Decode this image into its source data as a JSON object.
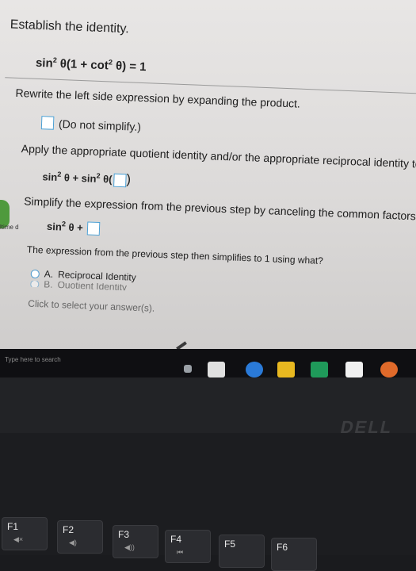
{
  "problem": {
    "title": "Establish the identity.",
    "identity": {
      "a": "sin",
      "sup1": "2",
      "b": "θ(1 + cot",
      "sup2": "2",
      "c": "θ) = 1"
    }
  },
  "steps": [
    {
      "text": "Rewrite the left side expression by expanding the product."
    },
    {
      "note": "(Do not simplify.)"
    },
    {
      "text": "Apply the appropriate quotient identity and/or the appropriate reciprocal identity to"
    },
    {
      "eq": {
        "a": "sin",
        "sup1": "2",
        "b": "θ + sin",
        "sup2": "2",
        "c": "θ("
      }
    },
    {
      "text": "Simplify the expression from the previous step by canceling the common factors."
    },
    {
      "eq": {
        "a": "sin",
        "sup1": "2",
        "b": "θ +"
      }
    },
    {
      "text": "The expression from the previous step then simplifies to 1 using what?"
    }
  ],
  "choices": [
    {
      "label": "A.",
      "text": "Reciprocal Identity"
    },
    {
      "label": "B.",
      "text": "Quotient Identity"
    }
  ],
  "hint": "Click to select your answer(s).",
  "sidebar": {
    "time": "ltime d"
  },
  "taskbar": {
    "search_placeholder": "Type here to search"
  },
  "laptop": {
    "brand": "DELL"
  },
  "keys": [
    {
      "label": "F1",
      "sub": "◀×"
    },
    {
      "label": "F2",
      "sub": "◀)"
    },
    {
      "label": "F3",
      "sub": "◀))"
    },
    {
      "label": "F4",
      "sub": "⏮"
    },
    {
      "label": "F5",
      "sub": ""
    },
    {
      "label": "F6",
      "sub": ""
    }
  ],
  "colors": {
    "answer_box_border": "#4a9fd3",
    "radio_border": "#4f9bcf",
    "side_tab": "#4f9a3d"
  }
}
